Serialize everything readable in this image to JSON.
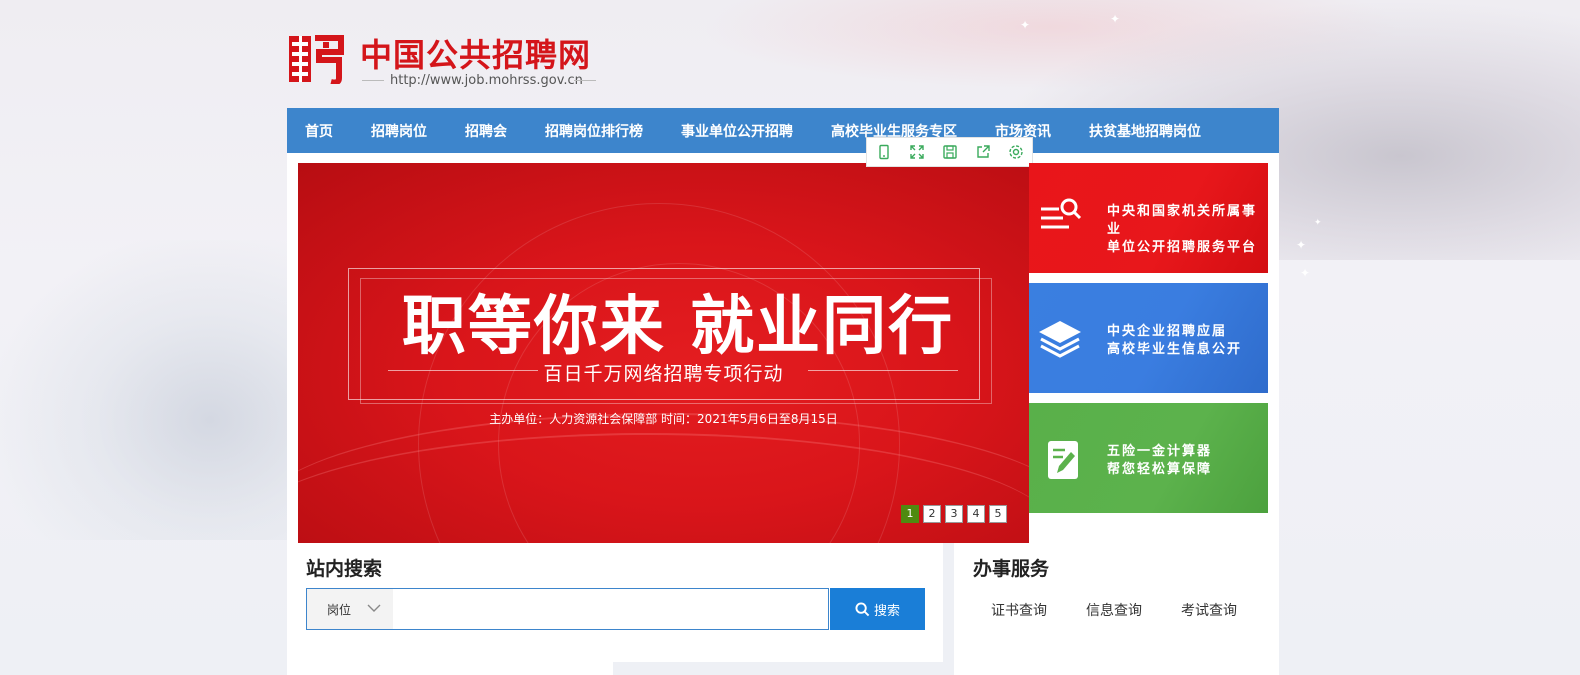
{
  "header": {
    "title": "中国公共招聘网",
    "url": "http://www.job.mohrss.gov.cn"
  },
  "nav": {
    "items": [
      {
        "label": "首页"
      },
      {
        "label": "招聘岗位"
      },
      {
        "label": "招聘会"
      },
      {
        "label": "招聘岗位排行榜"
      },
      {
        "label": "事业单位公开招聘"
      },
      {
        "label": "高校毕业生服务专区"
      },
      {
        "label": "市场资讯"
      },
      {
        "label": "扶贫基地招聘岗位"
      }
    ]
  },
  "banner": {
    "headline": "职等你来  就业同行",
    "subtitle": "百日千万网络招聘专项行动",
    "info": "主办单位：人力资源社会保障部      时间：2021年5月6日至8月15日",
    "pages": [
      "1",
      "2",
      "3",
      "4",
      "5"
    ],
    "active_page": "1"
  },
  "toolbar": {
    "icons": [
      "mobile-icon",
      "fullscreen-icon",
      "save-icon",
      "share-icon",
      "settings-icon"
    ]
  },
  "side_cards": [
    {
      "line1": "中央和国家机关所属事业",
      "line2": "单位公开招聘服务平台",
      "color": "#e8171b",
      "icon": "search-list-icon"
    },
    {
      "line1": "中央企业招聘应届",
      "line2": "高校毕业生信息公开",
      "color": "#3a7de0",
      "icon": "layers-icon"
    },
    {
      "line1": "五险一金计算器",
      "line2": "帮您轻松算保障",
      "color": "#5cb24c",
      "icon": "edit-note-icon"
    }
  ],
  "search": {
    "section_title": "站内搜索",
    "select_value": "岗位",
    "placeholder": "",
    "button_label": "搜索"
  },
  "services": {
    "section_title": "办事服务",
    "links": [
      "证书查询",
      "信息查询",
      "考试查询"
    ]
  },
  "colors": {
    "brand_red": "#d4151a",
    "nav_blue": "#3d85cc",
    "search_blue": "#1a7ed7",
    "pager_active": "#4f8a10"
  }
}
